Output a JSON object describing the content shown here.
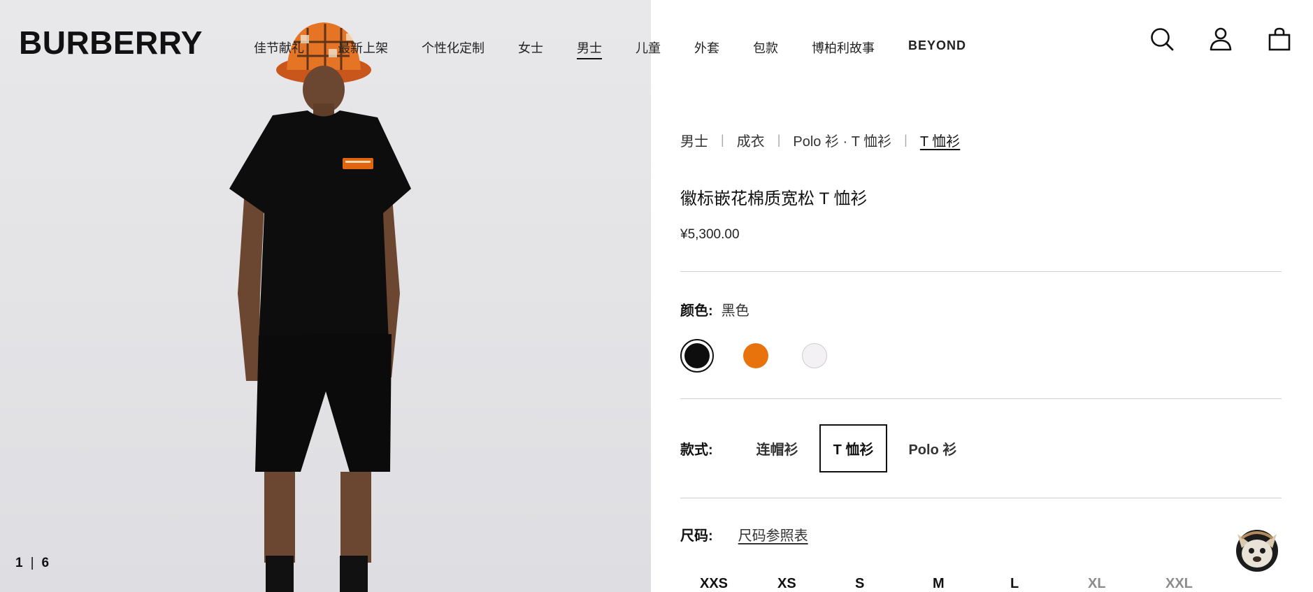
{
  "brand": "BURBERRY",
  "nav": [
    {
      "label": "佳节献礼",
      "active": false
    },
    {
      "label": "最新上架",
      "active": false
    },
    {
      "label": "个性化定制",
      "active": false
    },
    {
      "label": "女士",
      "active": false
    },
    {
      "label": "男士",
      "active": true
    },
    {
      "label": "儿童",
      "active": false
    },
    {
      "label": "外套",
      "active": false
    },
    {
      "label": "包款",
      "active": false
    },
    {
      "label": "博柏利故事",
      "active": false
    },
    {
      "label": "BEYOND",
      "active": false
    }
  ],
  "header_icons": [
    "search-icon",
    "account-icon",
    "bag-icon"
  ],
  "gallery": {
    "current": "1",
    "separator": "|",
    "total": "6"
  },
  "breadcrumb": [
    "男士",
    "成衣",
    "Polo 衫 · T 恤衫",
    "T 恤衫"
  ],
  "product": {
    "title": "徽标嵌花棉质宽松 T 恤衫",
    "price": "¥5,300.00"
  },
  "color": {
    "label": "颜色:",
    "value": "黑色",
    "swatches": [
      {
        "hex": "#0e0e0e",
        "selected": true
      },
      {
        "hex": "#e8720c",
        "selected": false
      },
      {
        "hex": "#f3f1f4",
        "selected": false
      }
    ]
  },
  "style": {
    "label": "款式:",
    "options": [
      {
        "label": "连帽衫",
        "selected": false
      },
      {
        "label": "T 恤衫",
        "selected": true
      },
      {
        "label": "Polo 衫",
        "selected": false
      }
    ]
  },
  "size": {
    "label": "尺码:",
    "guide_link": "尺码参照表",
    "options": [
      {
        "label": "XXS",
        "available": true
      },
      {
        "label": "XS",
        "available": true
      },
      {
        "label": "S",
        "available": true
      },
      {
        "label": "M",
        "available": true
      },
      {
        "label": "L",
        "available": true
      },
      {
        "label": "XL",
        "available": false
      },
      {
        "label": "XXL",
        "available": false
      }
    ]
  }
}
